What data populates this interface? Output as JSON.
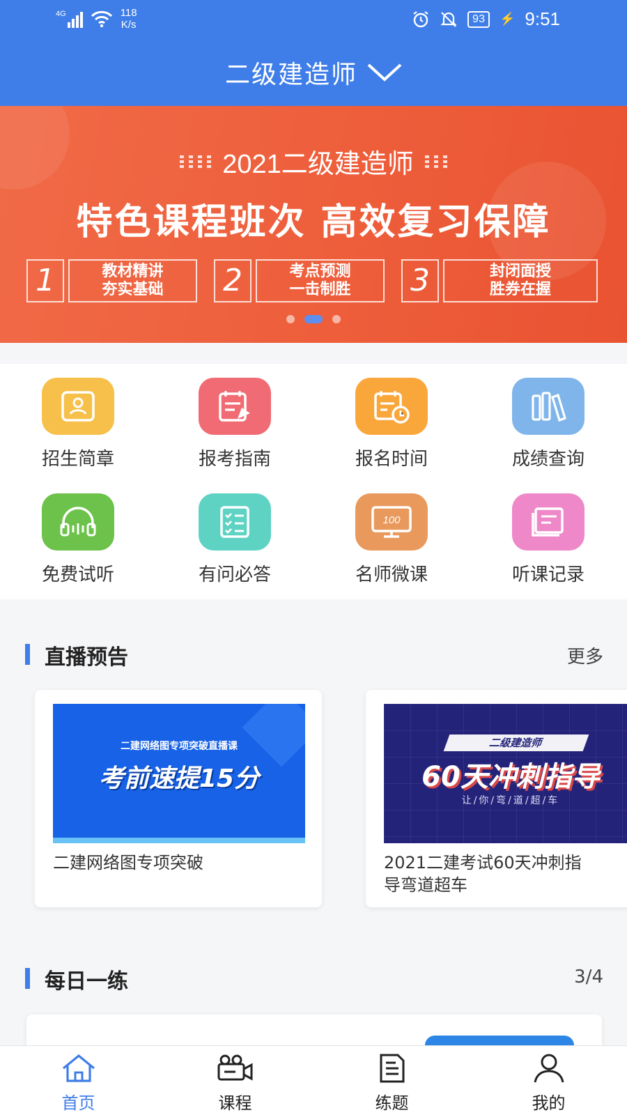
{
  "status_bar": {
    "network": "4G",
    "speed_value": "118",
    "speed_unit": "K/s",
    "battery": "93",
    "time": "9:51"
  },
  "header": {
    "title": "二级建造师"
  },
  "banner": {
    "top_line": "2021二级建造师",
    "headline": "特色课程班次 高效复习保障",
    "features": [
      {
        "num": "1",
        "line1": "教材精讲",
        "line2": "夯实基础"
      },
      {
        "num": "2",
        "line1": "考点预测",
        "line2": "一击制胜"
      },
      {
        "num": "3",
        "line1": "封闭面授",
        "line2": "胜券在握"
      }
    ],
    "page_count": 3,
    "active_page": 1
  },
  "grid": [
    {
      "label": "招生简章",
      "icon": "brochure-icon",
      "color": "#f7c04a"
    },
    {
      "label": "报考指南",
      "icon": "guide-icon",
      "color": "#f06b73"
    },
    {
      "label": "报名时间",
      "icon": "calendar-clock-icon",
      "color": "#f9a63a"
    },
    {
      "label": "成绩查询",
      "icon": "books-icon",
      "color": "#7fb5ea"
    },
    {
      "label": "免费试听",
      "icon": "headphones-icon",
      "color": "#6cc24a"
    },
    {
      "label": "有问必答",
      "icon": "checklist-icon",
      "color": "#5fd3c3"
    },
    {
      "label": "名师微课",
      "icon": "monitor-100-icon",
      "color": "#e9995c"
    },
    {
      "label": "听课记录",
      "icon": "notebook-icon",
      "color": "#ee88c8"
    }
  ],
  "live": {
    "title": "直播预告",
    "more": "更多",
    "cards": [
      {
        "img_small": "二建网络图专项突破直播课",
        "img_big": "考前速提15分",
        "caption": "二建网络图专项突破"
      },
      {
        "img_small": "二级建造师",
        "img_big": "60天冲刺指导",
        "img_sub": "让/你/弯/道/超/车",
        "caption_line1": "2021二建考试60天冲刺指",
        "caption_line2": "导弯道超车"
      }
    ]
  },
  "daily": {
    "title": "每日一练",
    "counter": "3/4"
  },
  "tabbar": [
    {
      "label": "首页",
      "icon": "home-icon",
      "active": true
    },
    {
      "label": "课程",
      "icon": "video-camera-icon",
      "active": false
    },
    {
      "label": "练题",
      "icon": "document-icon",
      "active": false
    },
    {
      "label": "我的",
      "icon": "user-icon",
      "active": false
    }
  ]
}
